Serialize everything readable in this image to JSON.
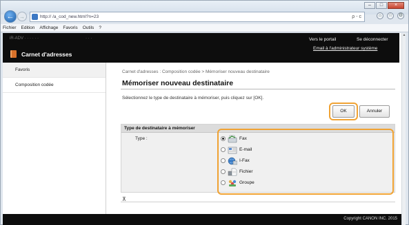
{
  "browser": {
    "address": "http://                    /a_cod_new.html?n=23",
    "address_right": "ρ - c",
    "menu": [
      "Fichier",
      "Edition",
      "Affichage",
      "Favoris",
      "Outils",
      "?"
    ],
    "window_buttons": [
      "–",
      "□",
      "×"
    ],
    "toolbar_icons": [
      "home-icon",
      "star-icon",
      "gear-icon"
    ]
  },
  "header": {
    "device_info": "iR-ADV  ·  ·  ·  ·  ·  ·",
    "user_info": "·  ·  ·",
    "portal_link": "Vers le portail",
    "logout_link": "Se déconnecter",
    "email_admin_link": "Email à l'administrateur système",
    "app_title": "Carnet d'adresses"
  },
  "sidebar": {
    "items": [
      {
        "label": "Favoris"
      },
      {
        "label": "Composition codée"
      }
    ]
  },
  "content": {
    "breadcrumb": "Carnet d'adresses : Composition codée > Mémoriser nouveau destinataire",
    "title": "Mémoriser nouveau destinataire",
    "instruction": "Sélectionnez le type de destinataire à mémoriser, puis cliquez sur [OK].",
    "ok_label": "OK",
    "cancel_label": "Annuler",
    "section_title": "Type de destinataire à mémoriser",
    "type_label": "Type :",
    "options": [
      {
        "label": "Fax",
        "icon": "fax-icon",
        "selected": true
      },
      {
        "label": "E-mail",
        "icon": "email-icon",
        "selected": false
      },
      {
        "label": "I-Fax",
        "icon": "ifax-icon",
        "selected": false
      },
      {
        "label": "Fichier",
        "icon": "file-server-icon",
        "selected": false
      },
      {
        "label": "Groupe",
        "icon": "group-icon",
        "selected": false
      }
    ],
    "go_top_symbol": "⊼"
  },
  "footer": {
    "copyright": "Copyright CANON INC. 2015"
  },
  "colors": {
    "highlight_ring": "#f0a232",
    "header_bg": "#0d0d0d",
    "accent_icon": "#d8712a"
  }
}
